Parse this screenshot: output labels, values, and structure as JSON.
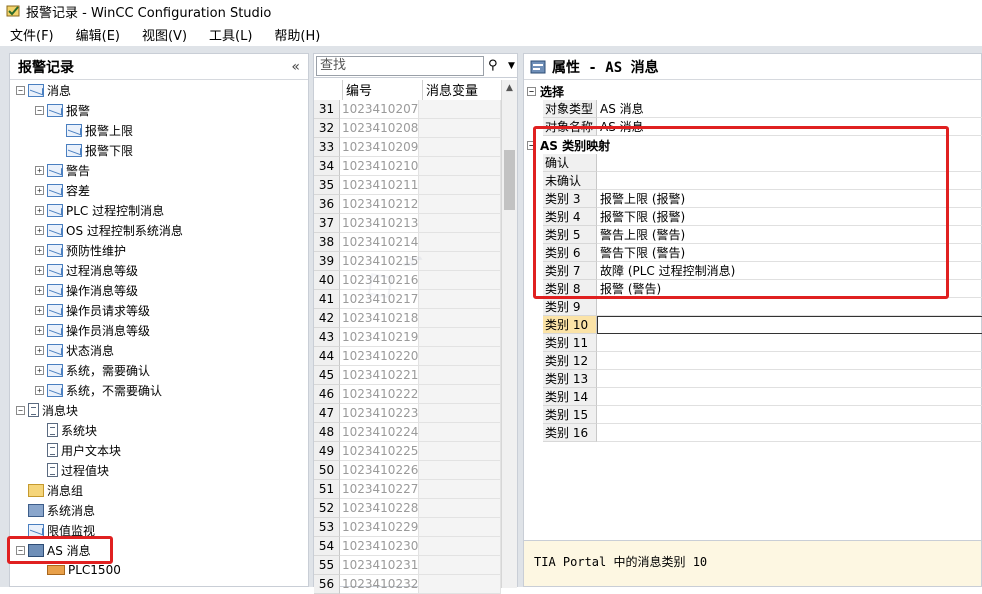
{
  "window": {
    "title": "报警记录 - WinCC Configuration Studio"
  },
  "menu": [
    "文件(F)",
    "编辑(E)",
    "视图(V)",
    "工具(L)",
    "帮助(H)"
  ],
  "left_panel": {
    "title": "报警记录",
    "collapse_glyph": "«",
    "tree": [
      {
        "label": "消息",
        "exp": "−",
        "icon": "message-icon"
      },
      {
        "label": "报警",
        "exp": "−",
        "icon": "message-icon"
      },
      {
        "label": "报警上限",
        "exp": "",
        "icon": "message-icon"
      },
      {
        "label": "报警下限",
        "exp": "",
        "icon": "message-icon"
      },
      {
        "label": "警告",
        "exp": "+",
        "icon": "message-icon"
      },
      {
        "label": "容差",
        "exp": "+",
        "icon": "message-icon"
      },
      {
        "label": "PLC 过程控制消息",
        "exp": "+",
        "icon": "message-icon"
      },
      {
        "label": "OS 过程控制系统消息",
        "exp": "+",
        "icon": "message-icon"
      },
      {
        "label": "预防性维护",
        "exp": "+",
        "icon": "message-icon"
      },
      {
        "label": "过程消息等级",
        "exp": "+",
        "icon": "message-icon"
      },
      {
        "label": "操作消息等级",
        "exp": "+",
        "icon": "message-icon"
      },
      {
        "label": "操作员请求等级",
        "exp": "+",
        "icon": "message-icon"
      },
      {
        "label": "操作员消息等级",
        "exp": "+",
        "icon": "message-icon"
      },
      {
        "label": "状态消息",
        "exp": "+",
        "icon": "message-icon"
      },
      {
        "label": "系统，需要确认",
        "exp": "+",
        "icon": "message-icon"
      },
      {
        "label": "系统，不需要确认",
        "exp": "+",
        "icon": "message-icon"
      },
      {
        "label": "消息块",
        "exp": "−",
        "icon": "document-icon"
      },
      {
        "label": "系统块",
        "exp": "",
        "icon": "document-icon"
      },
      {
        "label": "用户文本块",
        "exp": "",
        "icon": "document-icon"
      },
      {
        "label": "过程值块",
        "exp": "",
        "icon": "document-icon"
      },
      {
        "label": "消息组",
        "exp": "",
        "icon": "folder-icon"
      },
      {
        "label": "系统消息",
        "exp": "",
        "icon": "computer-icon"
      },
      {
        "label": "限值监视",
        "exp": "",
        "icon": "message-icon"
      },
      {
        "label": "AS 消息",
        "exp": "−",
        "icon": "as-icon"
      },
      {
        "label": "PLC1500",
        "exp": "",
        "icon": "plc-icon"
      }
    ]
  },
  "middle_panel": {
    "search_placeholder": "查找",
    "col_number": "编号",
    "col_var": "消息变量",
    "rows": [
      {
        "n": "31",
        "id": "1023410207"
      },
      {
        "n": "32",
        "id": "1023410208"
      },
      {
        "n": "33",
        "id": "1023410209"
      },
      {
        "n": "34",
        "id": "1023410210"
      },
      {
        "n": "35",
        "id": "1023410211"
      },
      {
        "n": "36",
        "id": "1023410212"
      },
      {
        "n": "37",
        "id": "1023410213"
      },
      {
        "n": "38",
        "id": "1023410214"
      },
      {
        "n": "39",
        "id": "1023410215"
      },
      {
        "n": "40",
        "id": "1023410216"
      },
      {
        "n": "41",
        "id": "1023410217"
      },
      {
        "n": "42",
        "id": "1023410218"
      },
      {
        "n": "43",
        "id": "1023410219"
      },
      {
        "n": "44",
        "id": "1023410220"
      },
      {
        "n": "45",
        "id": "1023410221"
      },
      {
        "n": "46",
        "id": "1023410222"
      },
      {
        "n": "47",
        "id": "1023410223"
      },
      {
        "n": "48",
        "id": "1023410224"
      },
      {
        "n": "49",
        "id": "1023410225"
      },
      {
        "n": "50",
        "id": "1023410226"
      },
      {
        "n": "51",
        "id": "1023410227"
      },
      {
        "n": "52",
        "id": "1023410228"
      },
      {
        "n": "53",
        "id": "1023410229"
      },
      {
        "n": "54",
        "id": "1023410230"
      },
      {
        "n": "55",
        "id": "1023410231"
      },
      {
        "n": "56",
        "id": "1023410232"
      }
    ]
  },
  "right_panel": {
    "title": "属性 - AS 消息",
    "section_select": "选择",
    "select_rows": [
      {
        "k": "对象类型",
        "v": "AS 消息"
      },
      {
        "k": "对象名称",
        "v": "AS 消息"
      }
    ],
    "section_mapping": "AS 类别映射",
    "mapping_rows": [
      {
        "k": "确认",
        "v": ""
      },
      {
        "k": "未确认",
        "v": ""
      },
      {
        "k": "类别 3",
        "v": "报警上限 (报警)"
      },
      {
        "k": "类别 4",
        "v": "报警下限 (报警)"
      },
      {
        "k": "类别 5",
        "v": "警告上限 (警告)"
      },
      {
        "k": "类别 6",
        "v": "警告下限 (警告)"
      },
      {
        "k": "类别 7",
        "v": "故障 (PLC 过程控制消息)"
      },
      {
        "k": "类别 8",
        "v": "报警 (警告)"
      },
      {
        "k": "类别 9",
        "v": ""
      },
      {
        "k": "类别 10",
        "v": ""
      },
      {
        "k": "类别 11",
        "v": ""
      },
      {
        "k": "类别 12",
        "v": ""
      },
      {
        "k": "类别 13",
        "v": ""
      },
      {
        "k": "类别 14",
        "v": ""
      },
      {
        "k": "类别 15",
        "v": ""
      },
      {
        "k": "类别 16",
        "v": ""
      }
    ],
    "selected_row": "类别 10",
    "description": "TIA Portal 中的消息类别 10"
  },
  "colors": {
    "highlight_box": "#e02020",
    "selected_key": "#fbe3a7",
    "description_bg": "#fdf7e2"
  }
}
